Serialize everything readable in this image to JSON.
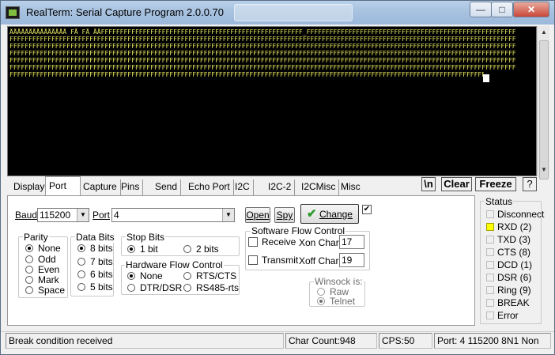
{
  "window": {
    "title": "RealTerm: Serial Capture Program 2.0.0.70",
    "min_glyph": "—",
    "max_glyph": "□",
    "close_glyph": "✕"
  },
  "terminal": {
    "lines": [
      "ÅÅÅÅÅÅÅÅÅÅÅÅÅÅÅ FÅ FÅ ÅÅFFFFFFFFFFFFFFFFFFFFFFFFFFFFFFFFFFFFFFFFFFFFFFFFFFFFF_FFFFFFFFFFFFFFFFFFFFFFFFFFFFFFFFFFFFFFFFFFFFFFFFFFFFFFFFFFFFFFF",
      "FFFFFFFFFFFFFFFFFFFFFFFFFFFFFFFFFFFFFFFFFFFFFFFFFFFFFFFFFFFFFFFFFFFFFFFFFFFFFFFFFFFFFFFFFFFFFFFFFFFFFFFFFFFFFFFFFFFFFFFFFFFFFFFFFFFFFFFFFFFF",
      "FFFFFFFFFFFFFFFFFFFFFFFFFFFFFFFFFFFFFFFFFFFFFFFFFFFFFFFFFFFFFFFFFFFFFFFFFFFFFFFFFFFFFFFFFFFFFFFFFFFFFFFFFFFFFFFFFFFFFFFFFFFFFFFFFFFFFFFFFFFF",
      "FFFFFFFFFFFFFFFFFFFFFFFFFFFFFFFFFFFFFFFFFFFFFFFFFFFFFFFFFFFFFFFFFFFFFFFFFFFFFFFFFFFFFFFFFFFFFFFFFFFFFFFFFFFFFFFFFFFFFFFFFFFFFFFFFFFFFFFFFFFF",
      "FFFFFFFFFFFFFFFFFFFFFFFFFFFFFFFFFFFFFFFFFFFFFFFFFFFFFFFFFFFFFFFFFFFFFFFFFFFFFFFFFFFFFFFFFFFFFFFFFFFFFFFFFFFFFFFFFFFFFFFFFFFFFFFFFFFFFFFFFFFF",
      "FFFFFFFFFFFFFFFFFFFFFFFFFFFFFFFFFFFFFFFFFFFFFFFFFFFFFFFFFFFFFFFFFFFFFFFFFFFFFFFFFFFFFFFFFFFFFFFFFFFFFFFFFFFFFFFFFFFFFFFFFFFFFFFFFFFFFFFFFFFF",
      "FFFFFFFFFFFFFFFFFFFFFFFFFFFFFFFFFFFFFFFFFFFFFFFFFFFFFFFFFFFFFFFFFFFFFFFFFFFFFFFFFFFFFFFFFFFFFFFFFFFFFFFFFFFFFFFFFFFFFFFFFFFFFFFFFFF_F"
    ],
    "text_color": "#e8e860",
    "background": "#000000"
  },
  "tabs": [
    {
      "label": "Display",
      "active": false
    },
    {
      "label": "Port",
      "active": true
    },
    {
      "label": "Capture",
      "active": false
    },
    {
      "label": "Pins",
      "active": false
    },
    {
      "label": "Send",
      "active": false
    },
    {
      "label": "Echo Port",
      "active": false
    },
    {
      "label": "I2C",
      "active": false
    },
    {
      "label": "I2C-2",
      "active": false
    },
    {
      "label": "I2CMisc",
      "active": false
    },
    {
      "label": "Misc",
      "active": false
    }
  ],
  "toolbar": {
    "newline_label": "\\n",
    "clear_label": "Clear",
    "freeze_label": "Freeze",
    "help_label": "?"
  },
  "port": {
    "baud_label": "Baud",
    "baud_value": "115200",
    "port_label": "Port",
    "port_value": "4",
    "open_label": "Open",
    "spy_label": "Spy",
    "change_label": "Change",
    "change_checked": true
  },
  "parity": {
    "title": "Parity",
    "options": [
      "None",
      "Odd",
      "Even",
      "Mark",
      "Space"
    ],
    "selected": "None"
  },
  "data_bits": {
    "title": "Data Bits",
    "options": [
      "8 bits",
      "7 bits",
      "6 bits",
      "5 bits"
    ],
    "selected": "8 bits"
  },
  "stop_bits": {
    "title": "Stop Bits",
    "options": [
      "1 bit",
      "2 bits"
    ],
    "selected": "1 bit"
  },
  "hw_flow": {
    "title": "Hardware Flow Control",
    "options": [
      "None",
      "RTS/CTS",
      "DTR/DSR",
      "RS485-rts"
    ],
    "selected": "None"
  },
  "sw_flow": {
    "title": "Software Flow Control",
    "receive_label": "Receive",
    "transmit_label": "Transmit",
    "xon_label": "Xon Char:",
    "xon_value": "17",
    "xoff_label": "Xoff Char:",
    "xoff_value": "19"
  },
  "winsock": {
    "title": "Winsock is:",
    "options": [
      "Raw",
      "Telnet"
    ],
    "selected": "Telnet"
  },
  "status": {
    "title": "Status",
    "items": [
      {
        "label": "Disconnect",
        "on": false
      },
      {
        "label": "RXD (2)",
        "on": true
      },
      {
        "label": "TXD (3)",
        "on": false
      },
      {
        "label": "CTS (8)",
        "on": false
      },
      {
        "label": "DCD (1)",
        "on": false
      },
      {
        "label": "DSR (6)",
        "on": false
      },
      {
        "label": "Ring (9)",
        "on": false
      },
      {
        "label": "BREAK",
        "on": false
      },
      {
        "label": "Error",
        "on": false
      }
    ],
    "on_color": "#ffff00"
  },
  "statusbar": {
    "message": "Break condition received",
    "char_count": "Char Count:948",
    "cps": "CPS:50",
    "port_info": "Port: 4 115200 8N1 Non"
  }
}
